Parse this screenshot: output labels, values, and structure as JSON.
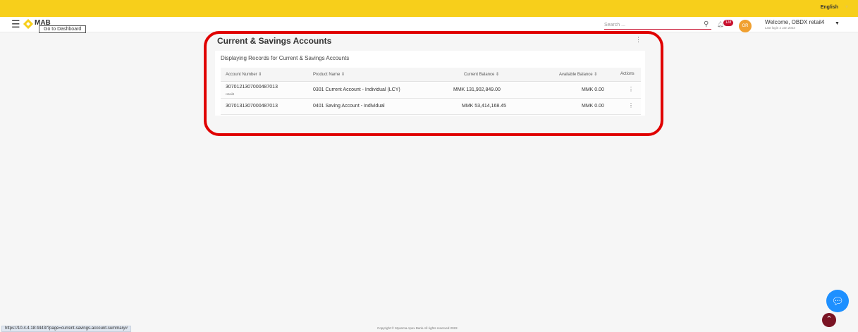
{
  "top_bar": {
    "language": "English"
  },
  "header": {
    "logo": "MAB",
    "tooltip": "Go to Dashboard",
    "search_placeholder": "Search ...",
    "notification_count": "128",
    "avatar_initials": "OR",
    "welcome": "Welcome, OBDX retail4",
    "last_login": "Last login 2 Jan 2023"
  },
  "panel": {
    "title": "Current & Savings Accounts",
    "subtitle": "Displaying Records for Current & Savings Accounts",
    "columns": [
      "Account Number",
      "Product Name",
      "Current Balance",
      "Available Balance",
      "Actions"
    ],
    "rows": [
      {
        "account_number": "3070121307000487013",
        "nickname": "retail4",
        "product_name": "0301 Current Account - Individual (LCY)",
        "current_balance": "MMK 131,902,849.00",
        "available_balance": "MMK 0.00"
      },
      {
        "account_number": "3070131307000487013",
        "product_name": "0401 Saving Account - Individual",
        "current_balance": "MMK 53,414,168.45",
        "available_balance": "MMK 0.00"
      }
    ]
  },
  "footer": {
    "status_url": "https://10.4.4.18:4443/?page=current-savings-account-summary#",
    "copyright": "Copyright © Myanma Apex Bank.All rights reserved 2022."
  },
  "colors": {
    "brand_yellow": "#f7cf1b",
    "highlight_red": "#e00000",
    "chat_blue": "#1e90ff",
    "scroll_top": "#7a1424"
  },
  "icons": [
    "menu-icon",
    "search-icon",
    "bell-icon",
    "kebab-icon",
    "chat-icon",
    "chevron-up-icon",
    "sort-icon"
  ]
}
